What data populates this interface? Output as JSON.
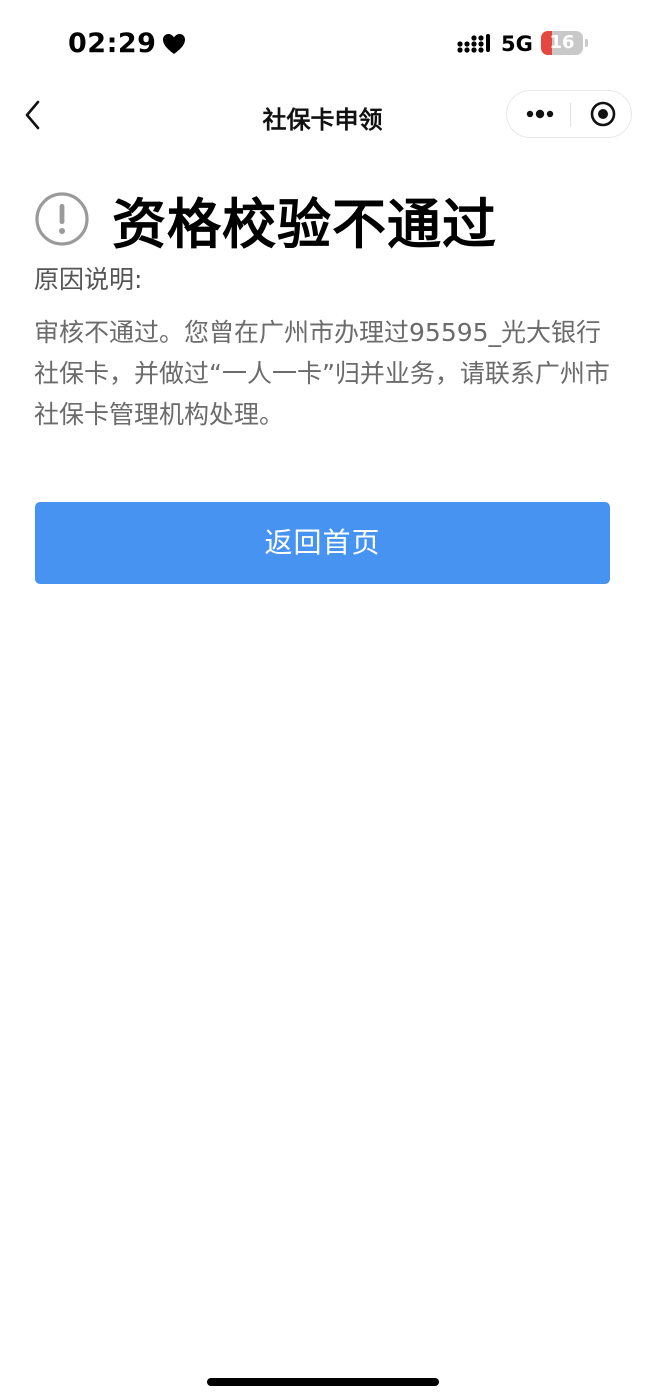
{
  "status_bar": {
    "time": "02:29",
    "network": "5G",
    "battery_level": "16",
    "battery_fraction": 0.16
  },
  "nav": {
    "title": "社保卡申领"
  },
  "result": {
    "title": "资格校验不通过",
    "reason_label": "原因说明:",
    "reason_text": "审核不通过。您曾在广州市办理过95595_光大银行社保卡，并做过“一人一卡”归并业务，请联系广州市社保卡管理机构处理。"
  },
  "actions": {
    "home_label": "返回首页"
  },
  "colors": {
    "primary": "#4693f1",
    "battery_low": "#e5483f",
    "text_secondary": "#6b6b6b"
  },
  "icons": {
    "back": "chevron-left-icon",
    "more": "more-dots-icon",
    "close": "target-circle-icon",
    "warning": "exclamation-circle-icon"
  }
}
